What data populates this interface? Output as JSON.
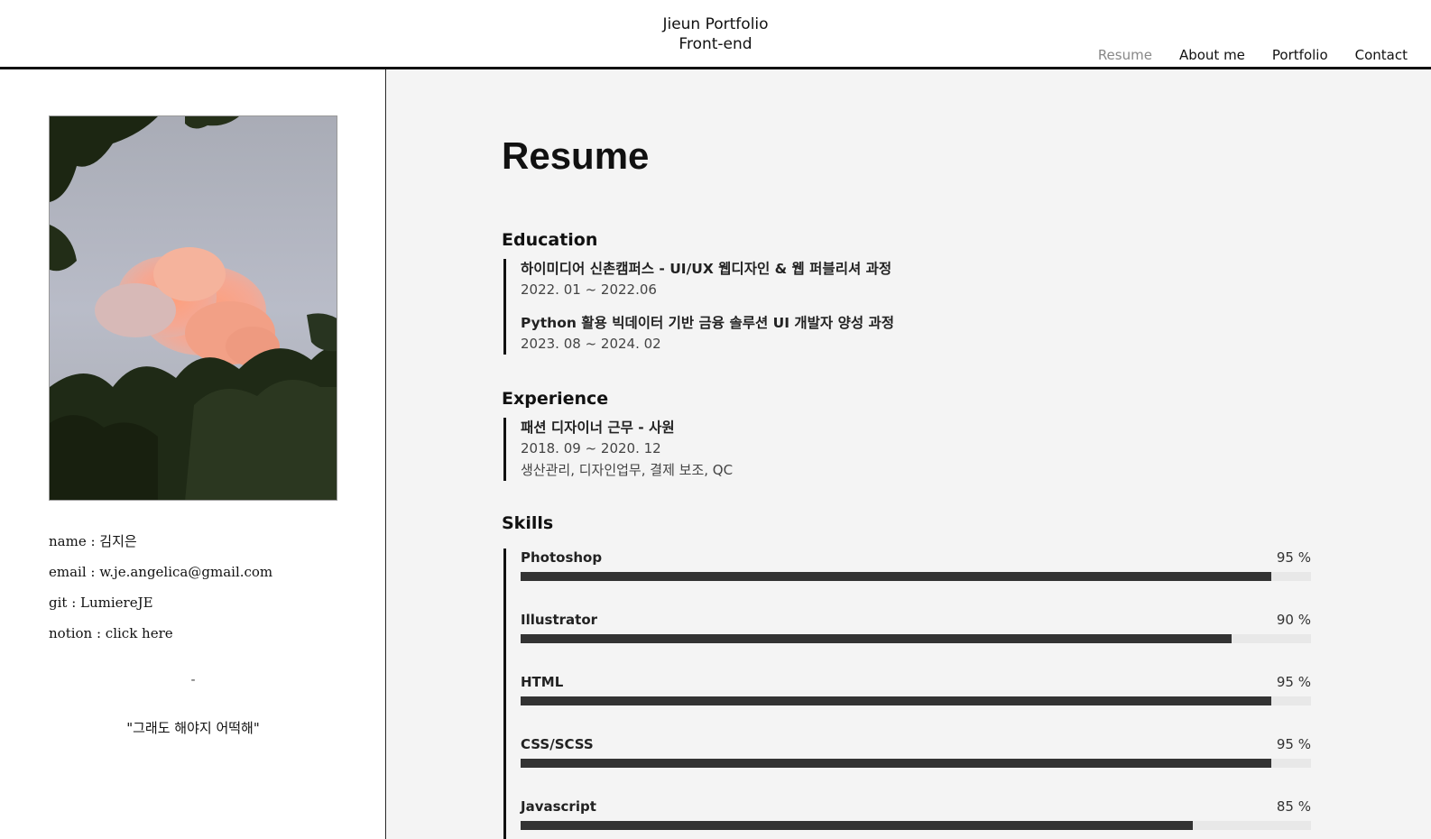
{
  "header": {
    "brand_line1": "Jieun Portfolio",
    "brand_line2": "Front-end",
    "nav": [
      {
        "label": "Resume",
        "active": true
      },
      {
        "label": "About me",
        "active": false
      },
      {
        "label": "Portfolio",
        "active": false
      },
      {
        "label": "Contact",
        "active": false
      }
    ]
  },
  "sidebar": {
    "info": {
      "name": "name : 김지은",
      "email": "email : w.je.angelica@gmail.com",
      "git": "git : LumiereJE",
      "notion": "notion : click here"
    },
    "divider": "-",
    "quote": "\"그래도 해야지 어떡해\""
  },
  "main": {
    "title": "Resume",
    "education": {
      "title": "Education",
      "items": [
        {
          "title": "하이미디어 신촌캠퍼스 - UI/UX 웹디자인 & 웹 퍼블리셔 과정",
          "period": "2022. 01 ~ 2022.06"
        },
        {
          "title": "Python 활용 빅데이터 기반 금융 솔루션 UI 개발자 양성 과정",
          "period": "2023. 08 ~ 2024. 02"
        }
      ]
    },
    "experience": {
      "title": "Experience",
      "items": [
        {
          "title": "패션 디자이너 근무 - 사원",
          "period": "2018. 09 ~ 2020. 12",
          "desc": "생산관리, 디자인업무, 결제 보조, QC"
        }
      ]
    },
    "skills": {
      "title": "Skills",
      "items": [
        {
          "name": "Photoshop",
          "percent_label": "95 %",
          "level": 95
        },
        {
          "name": "Illustrator",
          "percent_label": "90 %",
          "level": 90
        },
        {
          "name": "HTML",
          "percent_label": "95 %",
          "level": 95
        },
        {
          "name": "CSS/SCSS",
          "percent_label": "95 %",
          "level": 95
        },
        {
          "name": "Javascript",
          "percent_label": "85 %",
          "level": 85
        }
      ]
    }
  },
  "colors": {
    "main_bg": "#f4f4f4",
    "bar_fill": "#333333",
    "bar_track": "#e8e8e8",
    "nav_active": "#888888"
  }
}
